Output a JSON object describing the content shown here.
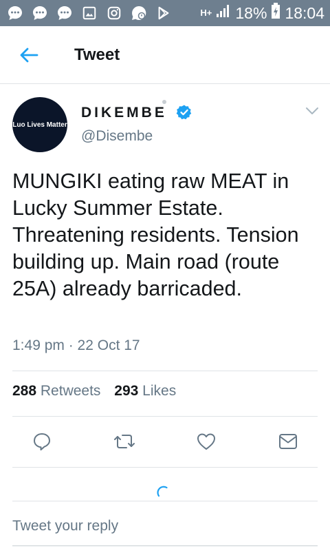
{
  "status_bar": {
    "battery": "18%",
    "time": "18:04",
    "network": "H+",
    "icons": [
      "chat-bubble-icon",
      "chat-bubble-icon",
      "chat-bubble-icon",
      "image-icon",
      "instagram-icon",
      "whatsapp-icon",
      "play-store-icon",
      "signal-icon",
      "battery-charging-icon"
    ]
  },
  "appbar": {
    "title": "Tweet"
  },
  "tweet": {
    "avatar_text": "Luo Lives Matter",
    "display_name": "DIKEMBE",
    "handle": "@Disembe",
    "text": "MUNGIKI eating raw MEAT in Lucky Summer Estate. Threatening residents. Tension building up. Main road (route 25A) already barricaded.",
    "timestamp": "1:49 pm · 22 Oct 17",
    "retweets_count": "288",
    "retweets_label": "Retweets",
    "likes_count": "293",
    "likes_label": "Likes"
  },
  "reply": {
    "placeholder": "Tweet your reply"
  },
  "colors": {
    "accent": "#1da1f2",
    "status_bar": "#6e7f8f",
    "secondary_text": "#657786",
    "avatar_bg": "#0b1529"
  }
}
